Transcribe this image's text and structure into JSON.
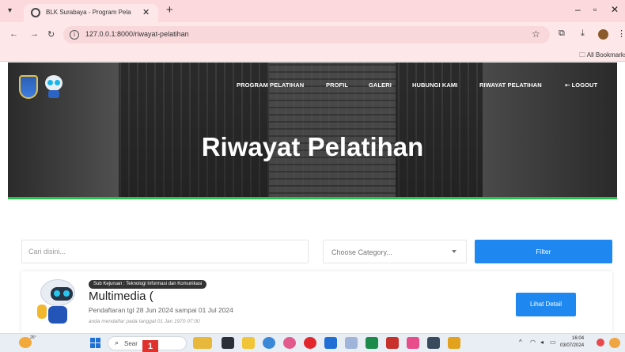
{
  "browser": {
    "tab_title": "BLK Surabaya - Program Pelatih",
    "url": "127.0.0.1:8000/riwayat-pelatihan",
    "bookmarks_label": "All Bookmarks"
  },
  "site": {
    "nav": [
      "PROGRAM PELATIHAN",
      "PROFIL",
      "GALERI",
      "HUBUNGI KAMI",
      "RIWAYAT PELATIHAN",
      "LOGOUT"
    ],
    "hero_title": "Riwayat Pelatihan"
  },
  "filter": {
    "search_placeholder": "Cari disini...",
    "category_placeholder": "Choose Category...",
    "filter_label": "Filter"
  },
  "results": [
    {
      "sub_kejuruan": "Sub Kejuruan : Teknologi Informasi dan Komunikasi",
      "title": "Multimedia (",
      "period": "Pendaftaran tgl 28 Jun 2024 sampai 01 Jul 2024",
      "registered": "anda mendaftar pada tanggal 01 Jan 1970 07:00",
      "detail_label": "Lihat Detail"
    }
  ],
  "taskbar": {
    "weather_temp": "26°",
    "search_text": "Sear",
    "badge": "1",
    "time": "16:04",
    "date": "03/07/2024"
  },
  "colors": {
    "accent": "#1e88f0",
    "hero_underline": "#26c24a",
    "chrome": "#fde7e9"
  }
}
